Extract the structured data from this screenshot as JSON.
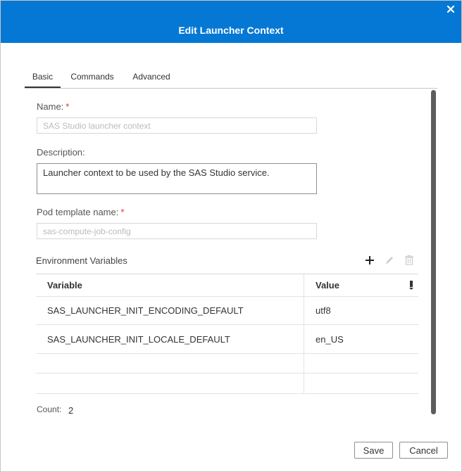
{
  "dialog": {
    "title": "Edit Launcher Context"
  },
  "tabs": [
    {
      "label": "Basic",
      "active": true
    },
    {
      "label": "Commands",
      "active": false
    },
    {
      "label": "Advanced",
      "active": false
    }
  ],
  "form": {
    "name_label": "Name:",
    "name_placeholder": "SAS Studio launcher context",
    "description_label": "Description:",
    "description_value": "Launcher context to be used by the SAS Studio service.",
    "pod_label": "Pod template name:",
    "pod_placeholder": "sas-compute-job-config",
    "required_mark": "*"
  },
  "env": {
    "title": "Environment Variables",
    "columns": [
      "Variable",
      "Value"
    ],
    "rows": [
      {
        "variable": "SAS_LAUNCHER_INIT_ENCODING_DEFAULT",
        "value": "utf8"
      },
      {
        "variable": "SAS_LAUNCHER_INIT_LOCALE_DEFAULT",
        "value": "en_US"
      },
      {
        "variable": "",
        "value": ""
      },
      {
        "variable": "",
        "value": ""
      }
    ],
    "count_label": "Count:",
    "count_value": "2",
    "icons": [
      "add-icon",
      "edit-icon",
      "delete-icon",
      "column-menu-icon"
    ]
  },
  "footer": {
    "save_label": "Save",
    "cancel_label": "Cancel"
  },
  "colors": {
    "titlebar": "#0478d4",
    "required": "#d8302f"
  }
}
